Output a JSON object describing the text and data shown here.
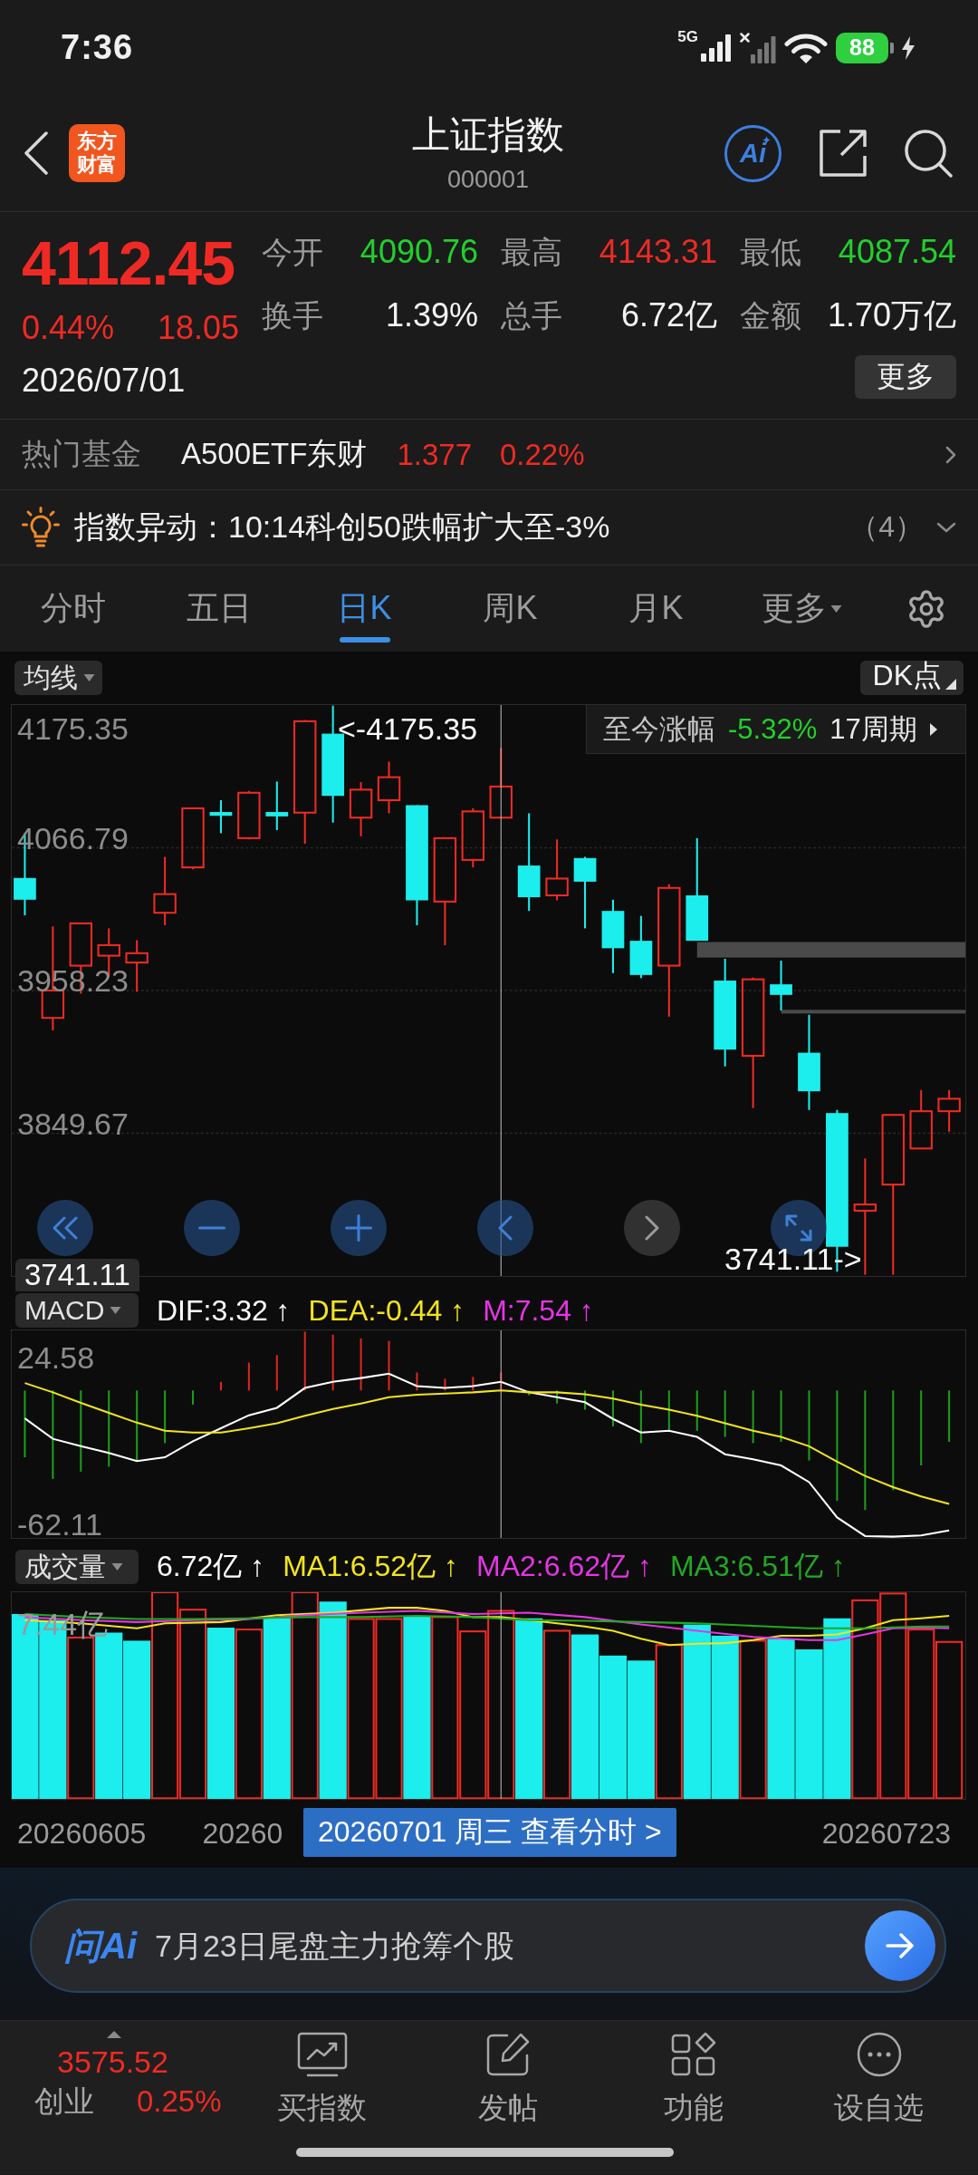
{
  "status_bar": {
    "time": "7:36",
    "network": "5G",
    "battery": "88"
  },
  "header": {
    "logo": [
      "东方",
      "财富"
    ],
    "title": "上证指数",
    "code": "000001",
    "ai_label": "Ai"
  },
  "quote": {
    "price": "4112.45",
    "change_pct": "0.44%",
    "change": "18.05",
    "rising": true,
    "date": "2026/07/01",
    "stats": [
      {
        "label": "今开",
        "value": "4090.76",
        "color": "#22cf2b"
      },
      {
        "label": "最高",
        "value": "4143.31",
        "color": "#ef2a24"
      },
      {
        "label": "最低",
        "value": "4087.54",
        "color": "#22cf2b"
      },
      {
        "label": "换手",
        "value": "1.39%",
        "color": "#f2f2f2"
      },
      {
        "label": "总手",
        "value": "6.72亿",
        "color": "#f2f2f2"
      },
      {
        "label": "金额",
        "value": "1.70万亿",
        "color": "#f2f2f2"
      }
    ],
    "more_button": "更多"
  },
  "hot_fund": {
    "label": "热门基金",
    "name": "A500ETF东财",
    "price": "1.377",
    "change_pct": "0.22%",
    "rising": true
  },
  "alert": {
    "text": "指数异动：10:14科创50跌幅扩大至-3%",
    "count": "（4）"
  },
  "tabs": [
    {
      "label": "分时",
      "selected": false,
      "dropdown": false
    },
    {
      "label": "五日",
      "selected": false,
      "dropdown": false
    },
    {
      "label": "日K",
      "selected": true,
      "dropdown": false
    },
    {
      "label": "周K",
      "selected": false,
      "dropdown": false
    },
    {
      "label": "月K",
      "selected": false,
      "dropdown": false
    },
    {
      "label": "更多",
      "selected": false,
      "dropdown": true
    }
  ],
  "price_chart": {
    "indicator": "均线",
    "dk_button": "DK点",
    "y_labels": [
      "4175.35",
      "4066.79",
      "3958.23",
      "3849.67"
    ],
    "high_marker": "<-4175.35",
    "low_marker": "3741.11->",
    "axis_min_label": "3741.11",
    "range_summary": {
      "label": "至今涨幅",
      "change": "-5.32%",
      "rising": false,
      "period": "17周期"
    },
    "controls": [
      {
        "kind": "fast-back",
        "disabled": false
      },
      {
        "kind": "zoom-out",
        "disabled": false
      },
      {
        "kind": "zoom-in",
        "disabled": false
      },
      {
        "kind": "back",
        "disabled": false
      },
      {
        "kind": "forward",
        "disabled": true
      },
      {
        "kind": "fullscreen",
        "disabled": false
      }
    ]
  },
  "macd": {
    "selector": "MACD",
    "readings": [
      {
        "text": "DIF:3.32 ↑",
        "color": "#ffffff"
      },
      {
        "text": "DEA:-0.44 ↑",
        "color": "#f2e41c"
      },
      {
        "text": "M:7.54 ↑",
        "color": "#e535e5"
      }
    ],
    "max_label": "24.58",
    "min_label": "-62.11"
  },
  "volume": {
    "selector": "成交量",
    "readings": [
      {
        "text": "6.72亿 ↑",
        "color": "#ffffff"
      },
      {
        "text": "MA1:6.52亿 ↑",
        "color": "#f2e41c"
      },
      {
        "text": "MA2:6.62亿 ↑",
        "color": "#e535e5"
      },
      {
        "text": "MA3:6.51亿 ↑",
        "color": "#22a822"
      }
    ],
    "max_label": "7.44亿"
  },
  "x_axis": {
    "labels": [
      "20260605",
      "20260",
      "20260723"
    ],
    "tooltip": "20260701 周三 查看分时 >"
  },
  "ask_ai": {
    "logo": "问Ai",
    "placeholder": "7月23日尾盘主力抢筹个股"
  },
  "bottom_nav": {
    "ticker": {
      "price": "3575.52",
      "name": "创业",
      "change_pct": "0.25%",
      "rising": true
    },
    "items": [
      {
        "label": "买指数",
        "kind": "chart"
      },
      {
        "label": "发帖",
        "kind": "post"
      },
      {
        "label": "功能",
        "kind": "apps"
      },
      {
        "label": "设自选",
        "kind": "more"
      }
    ]
  }
}
